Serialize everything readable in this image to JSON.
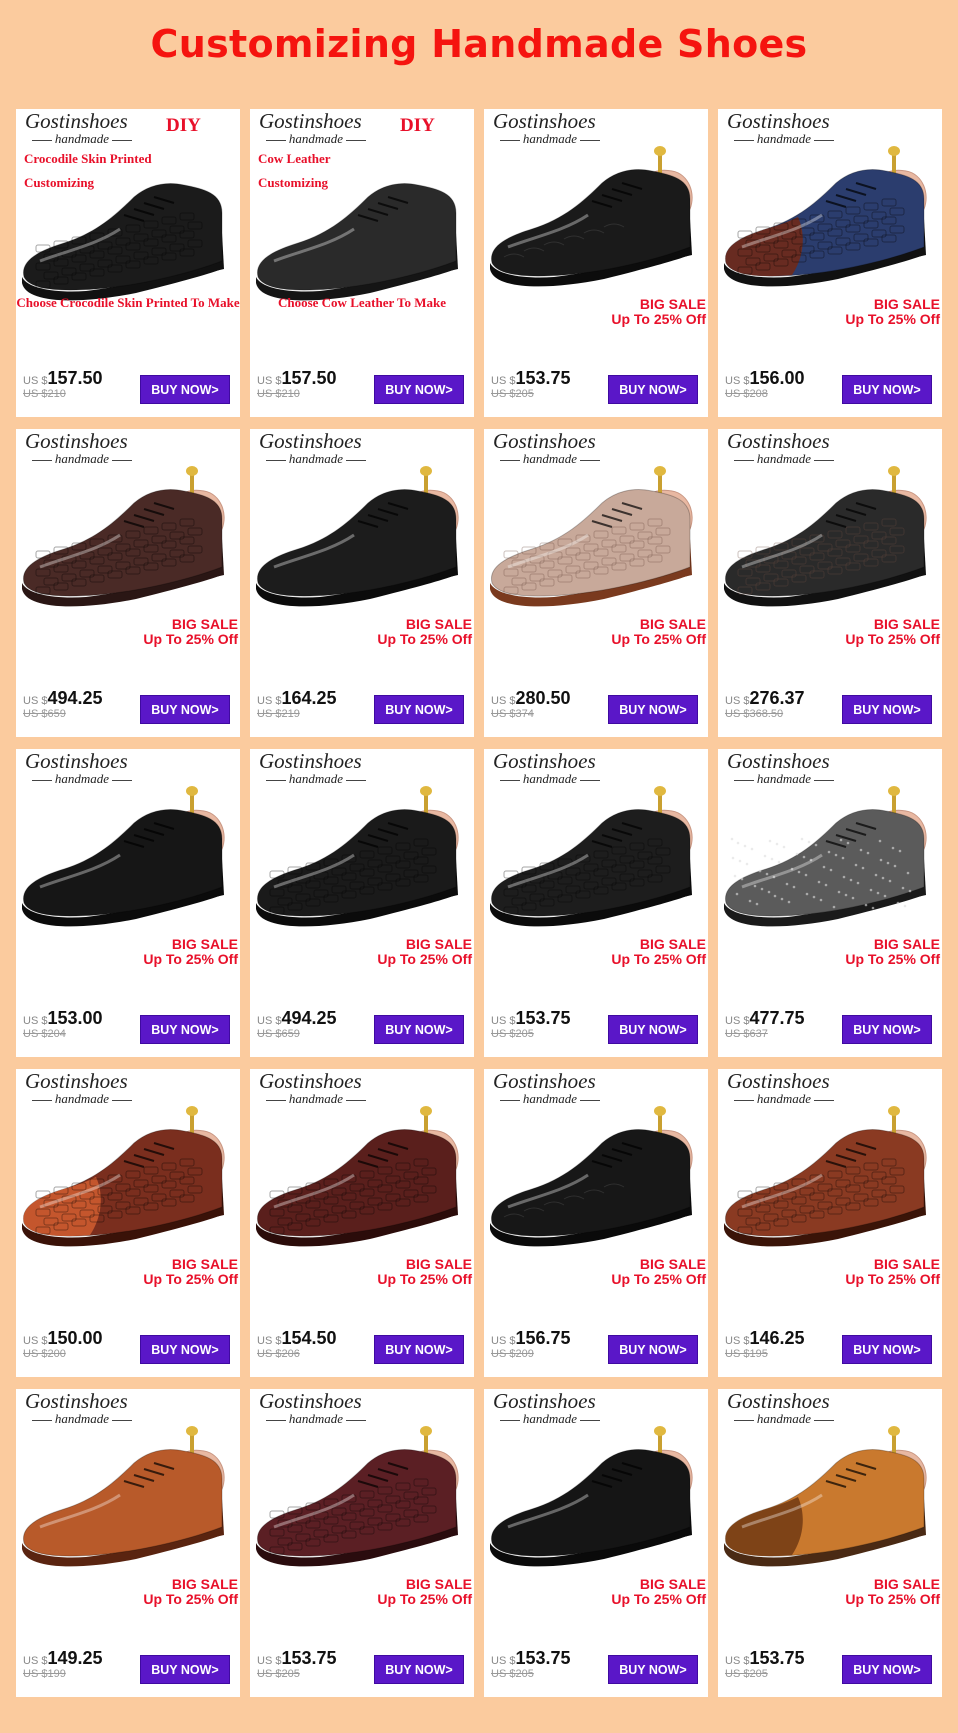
{
  "page": {
    "title": "Customizing Handmade Shoes"
  },
  "colors": {
    "background": "#fbcb9e",
    "title": "#f5140f",
    "sale": "#e8102a",
    "buy_button": "#5a17c8"
  },
  "common": {
    "brand": "Gostinshoes",
    "handmade": "handmade",
    "sale_line1": "BIG SALE",
    "sale_line2": "Up To 25% Off",
    "currency": "US $",
    "buy_label": "BUY NOW>"
  },
  "products": [
    {
      "price": "157.50",
      "old": "US $210",
      "diy": true,
      "diy_title": "DIY",
      "diy_lines": [
        "Crocodile Skin Printed",
        "Customizing"
      ],
      "diy_foot": "Choose Crocodile Skin Printed To Make",
      "shoe": "#1b1b1b",
      "sole": "#111111",
      "pattern": "croc"
    },
    {
      "price": "157.50",
      "old": "US $210",
      "diy": true,
      "diy_title": "DIY",
      "diy_lines": [
        "Cow Leather",
        "Customizing"
      ],
      "diy_foot": "Choose Cow Leather To Make",
      "shoe": "#2a2a2a",
      "sole": "#151515",
      "pattern": "plain"
    },
    {
      "price": "153.75",
      "old": "US $205",
      "shoe": "#1a1a1a",
      "sole": "#0c0c0c",
      "pattern": "grain"
    },
    {
      "price": "156.00",
      "old": "US $208",
      "shoe": "#2b3d6e",
      "sole": "#111111",
      "pattern": "weave",
      "toe": "#6b2a1c"
    },
    {
      "price": "494.25",
      "old": "US $659",
      "shoe": "#4a2a26",
      "sole": "#2a1614",
      "pattern": "croc"
    },
    {
      "price": "164.25",
      "old": "US $219",
      "shoe": "#1c1c1c",
      "sole": "#0b0b0b",
      "pattern": "plain"
    },
    {
      "price": "280.50",
      "old": "US $374",
      "shoe": "#c8a99a",
      "sole": "#7a3a1e",
      "pattern": "python"
    },
    {
      "price": "276.37",
      "old": "US $368.50",
      "shoe": "#2a2a2a",
      "sole": "#111111",
      "pattern": "python"
    },
    {
      "price": "153.00",
      "old": "US $204",
      "shoe": "#161616",
      "sole": "#0b0b0b",
      "pattern": "plain"
    },
    {
      "price": "494.25",
      "old": "US $659",
      "shoe": "#1a1a1a",
      "sole": "#0b0b0b",
      "pattern": "croc"
    },
    {
      "price": "153.75",
      "old": "US $205",
      "shoe": "#1d1d1d",
      "sole": "#0b0b0b",
      "pattern": "croc"
    },
    {
      "price": "477.75",
      "old": "US $637",
      "shoe": "#5b5b5b",
      "sole": "#1a1a1a",
      "pattern": "dots"
    },
    {
      "price": "150.00",
      "old": "US $200",
      "shoe": "#7a2e1e",
      "sole": "#3a1208",
      "pattern": "croc",
      "toe": "#c8582e"
    },
    {
      "price": "154.50",
      "old": "US $206",
      "shoe": "#5a1f1c",
      "sole": "#2b0c0a",
      "pattern": "croc"
    },
    {
      "price": "156.75",
      "old": "US $209",
      "shoe": "#171717",
      "sole": "#0a0a0a",
      "pattern": "grain"
    },
    {
      "price": "146.25",
      "old": "US $195",
      "shoe": "#8a3a22",
      "sole": "#3a1408",
      "pattern": "croc"
    },
    {
      "price": "149.25",
      "old": "US $199",
      "shoe": "#b85a2a",
      "sole": "#5a2410",
      "pattern": "plain"
    },
    {
      "price": "153.75",
      "old": "US $205",
      "shoe": "#5b1f24",
      "sole": "#2a0c0e",
      "pattern": "croc"
    },
    {
      "price": "153.75",
      "old": "US $205",
      "shoe": "#151515",
      "sole": "#0a0a0a",
      "pattern": "plain"
    },
    {
      "price": "153.75",
      "old": "US $205",
      "shoe": "#c9792e",
      "sole": "#4a2a14",
      "pattern": "plain",
      "toe": "#7a4016"
    }
  ]
}
